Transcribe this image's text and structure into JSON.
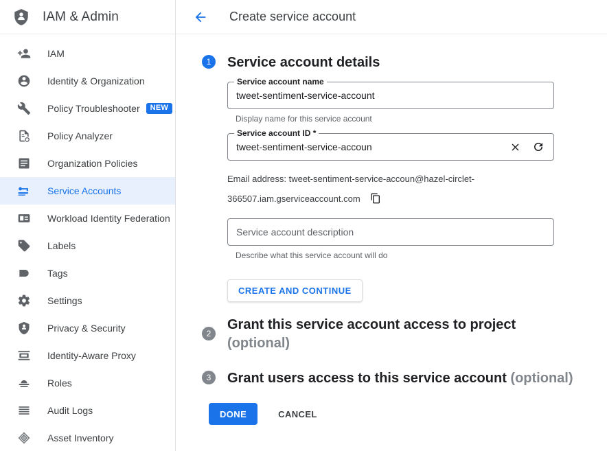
{
  "sidebar": {
    "brand": {
      "title": "IAM & Admin",
      "icon": "shield-person-icon"
    },
    "items": [
      {
        "label": "IAM",
        "icon": "person-add-icon",
        "active": false,
        "badge": null
      },
      {
        "label": "Identity & Organization",
        "icon": "account-circle-icon",
        "active": false,
        "badge": null
      },
      {
        "label": "Policy Troubleshooter",
        "icon": "wrench-icon",
        "active": false,
        "badge": "NEW"
      },
      {
        "label": "Policy Analyzer",
        "icon": "document-analyze-icon",
        "active": false,
        "badge": null
      },
      {
        "label": "Organization Policies",
        "icon": "list-document-icon",
        "active": false,
        "badge": null
      },
      {
        "label": "Service Accounts",
        "icon": "key-card-icon",
        "active": true,
        "badge": null
      },
      {
        "label": "Workload Identity Federation",
        "icon": "id-card-icon",
        "active": false,
        "badge": null
      },
      {
        "label": "Labels",
        "icon": "tag-icon",
        "active": false,
        "badge": null
      },
      {
        "label": "Tags",
        "icon": "bookmark-tag-icon",
        "active": false,
        "badge": null
      },
      {
        "label": "Settings",
        "icon": "gear-icon",
        "active": false,
        "badge": null
      },
      {
        "label": "Privacy & Security",
        "icon": "shield-icon",
        "active": false,
        "badge": null
      },
      {
        "label": "Identity-Aware Proxy",
        "icon": "proxy-icon",
        "active": false,
        "badge": null
      },
      {
        "label": "Roles",
        "icon": "roles-hat-icon",
        "active": false,
        "badge": null
      },
      {
        "label": "Audit Logs",
        "icon": "lines-icon",
        "active": false,
        "badge": null
      },
      {
        "label": "Asset Inventory",
        "icon": "diamonds-icon",
        "active": false,
        "badge": null
      }
    ]
  },
  "header": {
    "back_icon": "arrow-back-icon",
    "title": "Create service account"
  },
  "steps": {
    "one": {
      "number": "1",
      "heading": "Service account details",
      "name_field": {
        "label": "Service account name",
        "value": "tweet-sentiment-service-account",
        "placeholder": "",
        "hint": "Display name for this service account"
      },
      "id_field": {
        "label": "Service account ID *",
        "value": "tweet-sentiment-service-accoun",
        "placeholder": "",
        "clear_icon": "close-icon",
        "refresh_icon": "refresh-icon"
      },
      "email_label": "Email address: tweet-sentiment-service-accoun@hazel-circlet-366507.iam.gserviceaccount.com",
      "copy_icon": "copy-icon",
      "description_field": {
        "value": "",
        "placeholder": "Service account description",
        "hint": "Describe what this service account will do"
      },
      "primary_action": "CREATE AND CONTINUE"
    },
    "two": {
      "number": "2",
      "heading": "Grant this service account access to project",
      "optional": "(optional)"
    },
    "three": {
      "number": "3",
      "heading": "Grant users access to this service account",
      "optional": "(optional)"
    }
  },
  "footer": {
    "done_label": "DONE",
    "cancel_label": "CANCEL"
  },
  "colors": {
    "accent": "#1a73e8",
    "active_bg": "#e8f0fe",
    "muted": "#80868b",
    "text": "#202124"
  }
}
